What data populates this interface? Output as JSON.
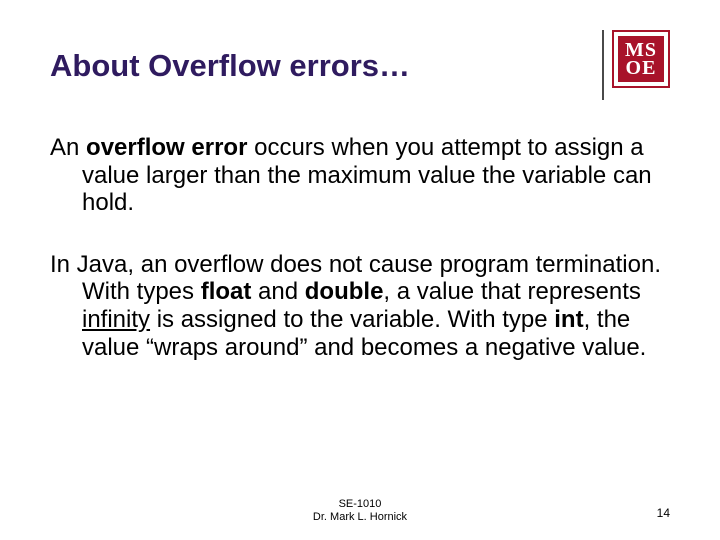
{
  "title": "About Overflow errors…",
  "logo": {
    "top": "MS",
    "bottom": "OE"
  },
  "p1": {
    "lead": "An ",
    "bold1": "overflow error",
    "rest": " occurs when you attempt to assign a value larger than the maximum value the variable can hold."
  },
  "p2": {
    "t1": "In Java, an overflow does not cause program termination. With types ",
    "b1": "float",
    "t2": " and ",
    "b2": "double",
    "t3": ", a value that represents ",
    "u1": "infinity",
    "t4": " is assigned to the variable. With type ",
    "b3": "int",
    "t5": ", the value “wraps around” and becomes a negative value."
  },
  "footer": {
    "course": "SE-1010",
    "author": "Dr. Mark L. Hornick"
  },
  "page": "14"
}
